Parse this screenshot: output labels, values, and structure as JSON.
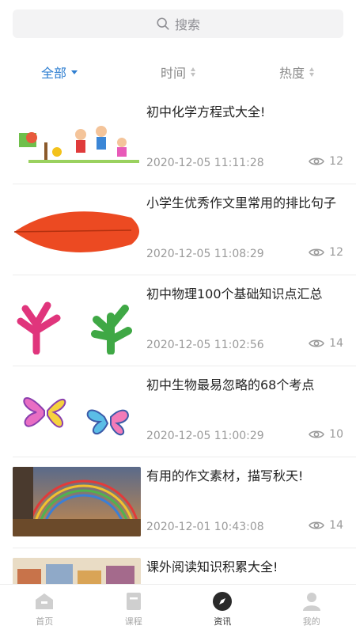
{
  "search": {
    "placeholder": "搜索",
    "icon": "search-icon"
  },
  "filters": [
    {
      "label": "全部",
      "active": true
    },
    {
      "label": "时间",
      "active": false
    },
    {
      "label": "热度",
      "active": false
    }
  ],
  "articles": [
    {
      "title": "初中化学方程式大全!",
      "date": "2020-12-05 11:11:28",
      "views": "12",
      "thumb": "kids-painting"
    },
    {
      "title": "小学生优秀作文里常用的排比句子",
      "date": "2020-12-05 11:08:29",
      "views": "12",
      "thumb": "red-leaf"
    },
    {
      "title": "初中物理100个基础知识点汇总",
      "date": "2020-12-05 11:02:56",
      "views": "14",
      "thumb": "coral-plants"
    },
    {
      "title": "初中生物最易忽略的68个考点",
      "date": "2020-12-05 11:00:29",
      "views": "10",
      "thumb": "butterflies"
    },
    {
      "title": "有用的作文素材，描写秋天!",
      "date": "2020-12-01 10:43:08",
      "views": "14",
      "thumb": "autumn-rainbow"
    },
    {
      "title": "课外阅读知识积累大全!",
      "date": "",
      "views": "",
      "thumb": "town"
    }
  ],
  "tabs": [
    {
      "label": "首页",
      "icon": "home-icon",
      "active": false
    },
    {
      "label": "课程",
      "icon": "course-icon",
      "active": false
    },
    {
      "label": "资讯",
      "icon": "compass-icon",
      "active": true
    },
    {
      "label": "我的",
      "icon": "user-icon",
      "active": false
    }
  ],
  "colors": {
    "accent": "#2f7fd1",
    "muted": "#9a9a9a",
    "search_bg": "#f3f3f4"
  }
}
